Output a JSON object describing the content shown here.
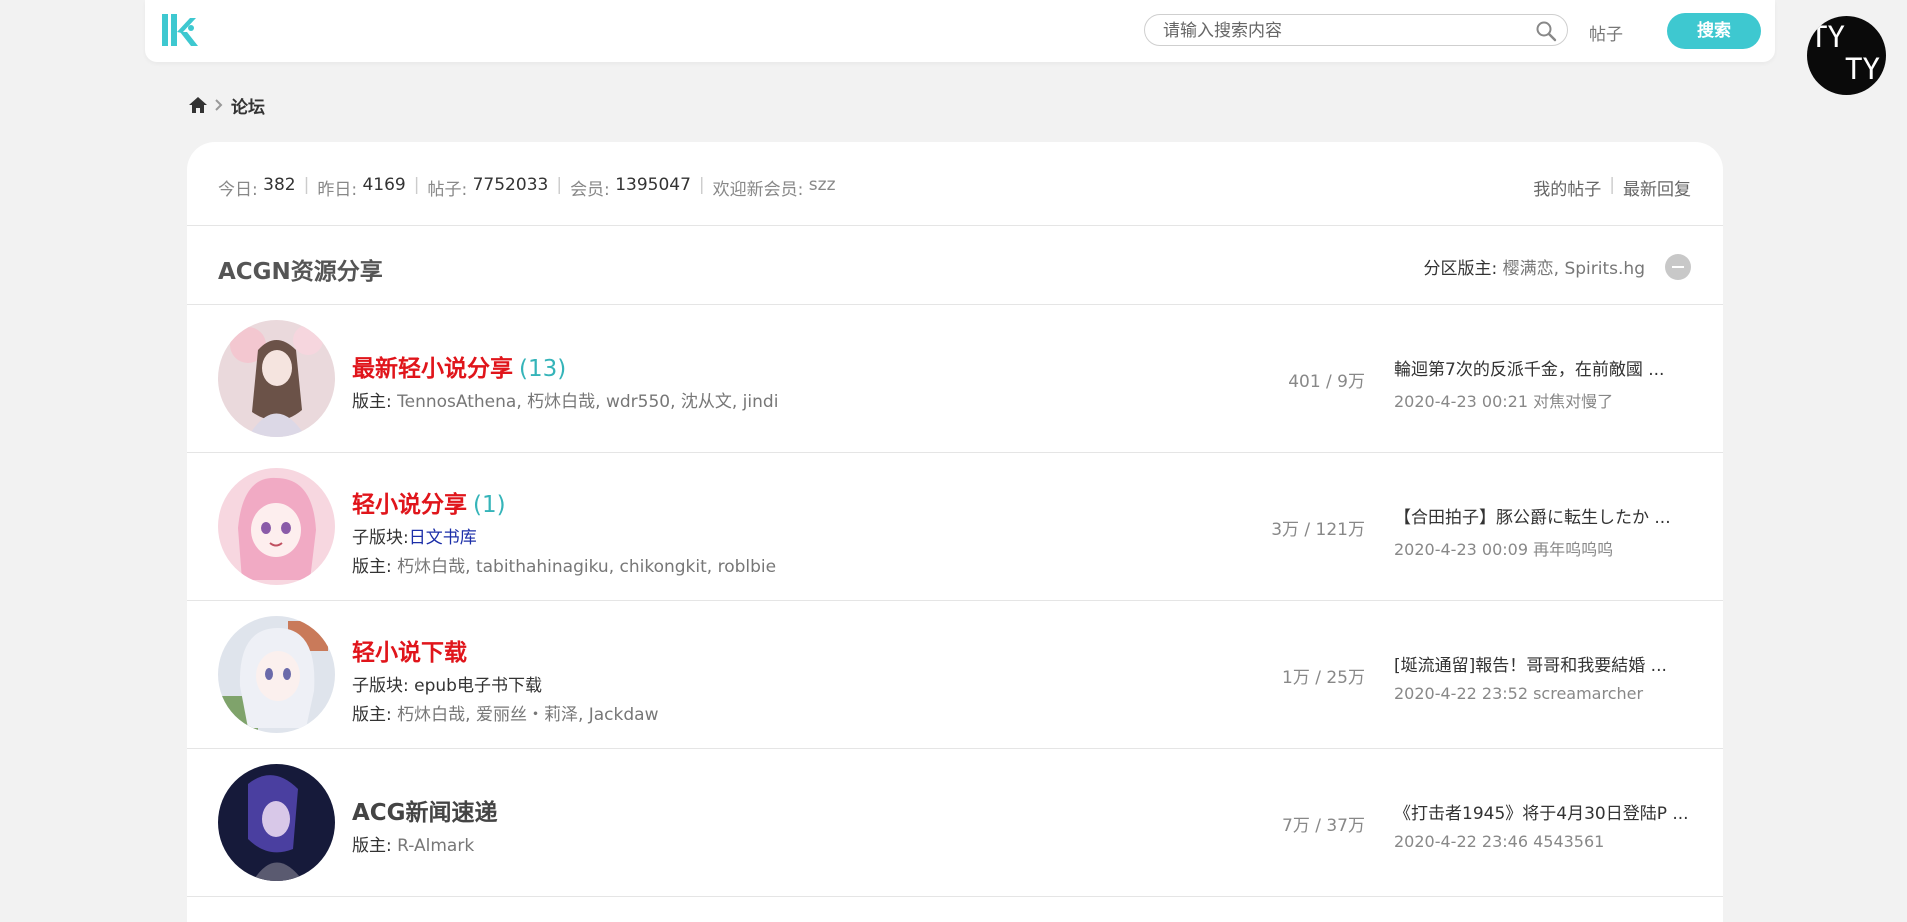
{
  "header": {
    "search_placeholder": "请输入搜索内容",
    "post_link": "帖子",
    "search_button": "搜索",
    "avatar_line1": "TY",
    "avatar_line2": "TY",
    "accent_color": "#3ec8d0"
  },
  "breadcrumb": {
    "current": "论坛"
  },
  "stats": {
    "today_label": "今日:",
    "today_value": "382",
    "yesterday_label": "昨日:",
    "yesterday_value": "4169",
    "posts_label": "帖子:",
    "posts_value": "7752033",
    "members_label": "会员:",
    "members_value": "1395047",
    "welcome_label": "欢迎新会员:",
    "welcome_value": "szz",
    "my_posts": "我的帖子",
    "latest_replies": "最新回复"
  },
  "section": {
    "title": "ACGN资源分享",
    "moderators_label": "分区版主:",
    "moderators_names": "樱满恋, Spirits.hg"
  },
  "forums": [
    {
      "name": "最新轻小说分享",
      "count": "(13)",
      "moderators_label": "版主:",
      "moderators": "TennosAthena, 朽炑白哉, wdr550, 沈从文, jindi",
      "stats": "401 / 9万",
      "last_title": "輪迴第7次的反派千金，在前敵國 ...",
      "last_meta": "2020-4-23 00:21 对焦对慢了",
      "icon": "anime-girl-sakura-avatar"
    },
    {
      "name": "轻小说分享",
      "count": "(1)",
      "sub_label": "子版块:",
      "sub_value": "日文书库",
      "moderators_label": "版主:",
      "moderators": "朽炑白哉, tabithahinagiku, chikongkit, roblbie",
      "stats": "3万 / 121万",
      "last_title": "【合田拍子】豚公爵に転生したか ...",
      "last_meta": "2020-4-23 00:09 再年呜呜呜",
      "icon": "anime-girl-pink-hair-avatar"
    },
    {
      "name": "轻小说下载",
      "sub_label": "子版块:",
      "sub_value": "epub电子书下载",
      "moderators_label": "版主:",
      "moderators": "朽炑白哉, 爱丽丝・莉泽, Jackdaw",
      "stats": "1万 / 25万",
      "last_title": "[埏流通留]報告！哥哥和我要結婚 ...",
      "last_meta": "2020-4-22 23:52 screamarcher",
      "icon": "anime-girl-silver-hair-avatar"
    },
    {
      "name": "ACG新闻速递",
      "moderators_label": "版主:",
      "moderators": "R-Almark",
      "stats": "7万 / 37万",
      "last_title": "《打击者1945》将于4月30日登陆P ...",
      "last_meta": "2020-4-22 23:46 4543561",
      "icon": "anime-character-blue-hair-avatar"
    }
  ]
}
